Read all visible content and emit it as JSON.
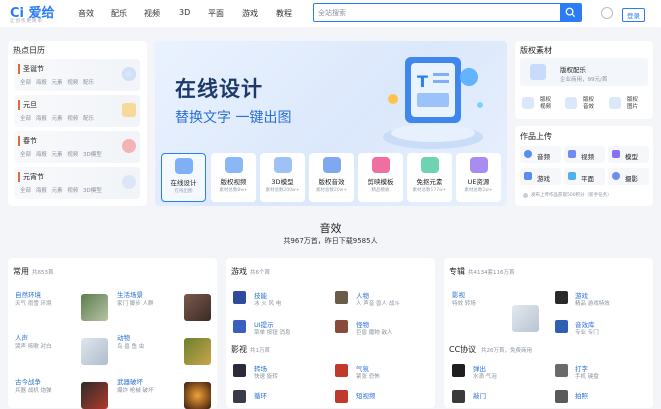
{
  "header": {
    "logo_text": "Ci 爱给",
    "logo_sub": "让创作更简单",
    "nav": [
      "音效",
      "配乐",
      "视频",
      "3D",
      "平面",
      "游戏",
      "教程"
    ],
    "search_placeholder": "全站搜索",
    "login_label": "登录"
  },
  "holidays": {
    "title": "热点日历",
    "items": [
      {
        "name": "圣诞节",
        "tags": "全部 海报 元素 视频 配乐"
      },
      {
        "name": "元旦",
        "tags": "全部 海报 元素 视频 配乐"
      },
      {
        "name": "春节",
        "tags": "全部 海报 元素 视频 3D模型"
      },
      {
        "name": "元宵节",
        "tags": "全部 海报 元素 视频 3D模型"
      }
    ]
  },
  "hero": {
    "title": "在线设计",
    "subtitle": "替换文字 一键出图",
    "tiles": [
      {
        "label": "在线设计",
        "sub": "在线出图"
      },
      {
        "label": "版权视频",
        "sub": "素材总数8w+"
      },
      {
        "label": "3D模型",
        "sub": "素材总数200w+"
      },
      {
        "label": "版权音效",
        "sub": "素材总数20w+"
      },
      {
        "label": "剪映模板",
        "sub": "精品模板"
      },
      {
        "label": "免抠元素",
        "sub": "素材总数177w+"
      },
      {
        "label": "UE资源",
        "sub": "素材总数2w+"
      }
    ]
  },
  "copyright": {
    "title": "版权素材",
    "featured_title": "版权配乐",
    "featured_sub": "企业商用，99元/首",
    "items": [
      "版权视频",
      "版权音效",
      "版权图片"
    ]
  },
  "upload": {
    "title": "作品上传",
    "items": [
      "音频",
      "视频",
      "模型",
      "游戏",
      "平面",
      "摄影"
    ],
    "note": "发布上传作品获取500积分（新手任务）"
  },
  "sfx": {
    "title": "音效",
    "stats": "共967万首，昨日下载9585人"
  },
  "common": {
    "title": "常用",
    "count": "共653首",
    "items": [
      {
        "name": "自然环境",
        "tags": "天气 雨雪 环境"
      },
      {
        "name": "生活场景",
        "tags": "家门 脚步 人群"
      },
      {
        "name": "人声",
        "tags": "哭声 咳嗽 对白"
      },
      {
        "name": "动物",
        "tags": "鸟 兽 鱼 虫"
      },
      {
        "name": "古今战争",
        "tags": "兵器 战机 炮弹"
      },
      {
        "name": "武器破坏",
        "tags": "爆炸 枪械 破坏"
      }
    ]
  },
  "games": {
    "title": "游戏",
    "count": "共6个首",
    "items": [
      {
        "name": "技能",
        "tags": "冰 火 风 电"
      },
      {
        "name": "人物",
        "tags": "人 声音 兽人 战斗"
      },
      {
        "name": "UI提示",
        "tags": "菜单 按钮 消息"
      },
      {
        "name": "怪物",
        "tags": "巨兽 魔物 敌人"
      }
    ],
    "film_title": "影视",
    "film_count": "共1万首",
    "film_items": [
      {
        "name": "转场",
        "tags": "快速 旋转"
      },
      {
        "name": "气氛",
        "tags": "紧张 恐怖"
      },
      {
        "name": "循环",
        "tags": ""
      },
      {
        "name": "短视频",
        "tags": ""
      }
    ]
  },
  "special": {
    "title": "专辑",
    "count": "共4134套116万首",
    "items": [
      {
        "name": "影视",
        "tags": "特效 转场"
      },
      {
        "name": "游戏",
        "tags": "精品 游戏特效"
      },
      {
        "name": "音效库",
        "tags": "专业 专门"
      }
    ],
    "cc_title": "CC协议",
    "cc_count": "共26万首，免费商用",
    "cc_items": [
      {
        "name": "弹出",
        "tags": "水滴 气泡"
      },
      {
        "name": "打字",
        "tags": "手机 键盘"
      },
      {
        "name": "敲门",
        "tags": ""
      },
      {
        "name": "拍照",
        "tags": ""
      }
    ]
  },
  "colors": {
    "accent": "#2a7df7",
    "holiday_bar": "#e06b43"
  }
}
